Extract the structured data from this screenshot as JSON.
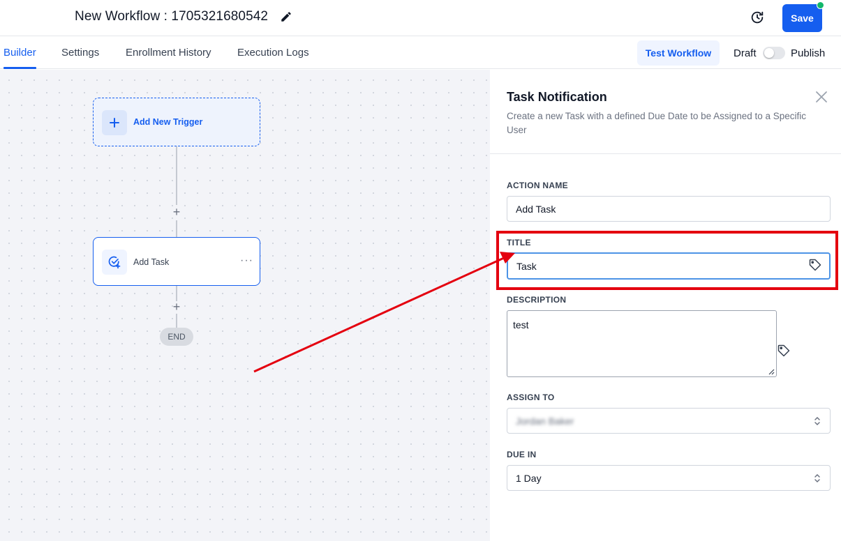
{
  "header": {
    "workflow_title": "New Workflow : 1705321680542",
    "save_label": "Save"
  },
  "tabs": [
    {
      "label": "Builder",
      "active": true
    },
    {
      "label": "Settings",
      "active": false
    },
    {
      "label": "Enrollment History",
      "active": false
    },
    {
      "label": "Execution Logs",
      "active": false
    }
  ],
  "actions": {
    "test_workflow_label": "Test Workflow",
    "draft_label": "Draft",
    "publish_label": "Publish",
    "publish_toggle_on": false
  },
  "canvas": {
    "trigger_label": "Add New Trigger",
    "task_label": "Add Task",
    "end_label": "END",
    "add_step_symbol": "+",
    "more_symbol": "···"
  },
  "panel": {
    "title": "Task Notification",
    "subtitle": "Create a new Task with a defined Due Date to be Assigned to a Specific User",
    "fields": {
      "action_name": {
        "label": "ACTION NAME",
        "value": "Add Task"
      },
      "title": {
        "label": "TITLE",
        "value": "Task"
      },
      "description": {
        "label": "DESCRIPTION",
        "value": "test"
      },
      "assign_to": {
        "label": "ASSIGN TO",
        "value": "Jordan Baker"
      },
      "due_in": {
        "label": "DUE IN",
        "value": "1 Day"
      }
    }
  },
  "colors": {
    "accent": "#155eef",
    "status_online": "#12b76a",
    "annotation": "#e4000f"
  },
  "icons": [
    "pencil-icon",
    "history-icon",
    "plus-icon",
    "task-check-icon",
    "close-icon",
    "tag-icon",
    "select-arrows-icon"
  ]
}
